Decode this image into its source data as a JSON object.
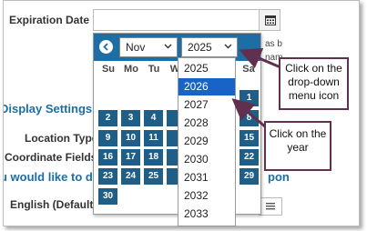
{
  "form": {
    "expiration_label": "Expiration Date",
    "side_text_1": "as b",
    "side_text_2": "nam",
    "display_settings_label": "Display Settings",
    "location_type_label": "Location Type",
    "coordinate_fields_label": "Coordinate Fields",
    "would_like_label": "u would like to di",
    "pon_text": "pon",
    "language_label": "English (Default)"
  },
  "calendar": {
    "prev_icon": "chevron-left-icon",
    "month_selected": "Nov",
    "year_selected": "2025",
    "weekdays": [
      "Su",
      "Mo",
      "Tu",
      "W",
      "Sa"
    ],
    "days_left": {
      "row1": [
        "2",
        "3",
        "4"
      ],
      "row2": [
        "9",
        "10",
        "11"
      ],
      "row3": [
        "16",
        "17",
        "18"
      ],
      "row4": [
        "23",
        "24",
        "25"
      ],
      "row5": [
        "30"
      ]
    },
    "days_right": [
      "1",
      "8",
      "15",
      "22",
      "29"
    ],
    "colors": {
      "header": "#1c6ea4",
      "day": "#1f5f87",
      "highlight": "#1a63c6",
      "callout_border": "#62304f"
    }
  },
  "year_dropdown": {
    "options": [
      "2025",
      "2026",
      "2027",
      "2028",
      "2029",
      "2030",
      "2031",
      "2032",
      "2033"
    ],
    "highlighted": "2026"
  },
  "callouts": {
    "dropdown_tip": "Click on the drop-down menu icon",
    "year_tip": "Click on the year"
  }
}
